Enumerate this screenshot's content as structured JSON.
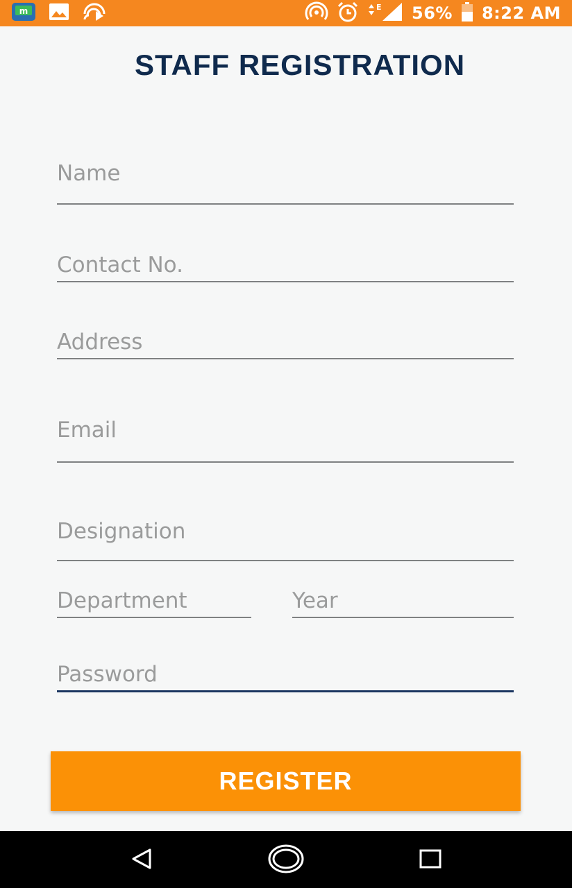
{
  "status_bar": {
    "battery": "56%",
    "time": "8:22 AM",
    "network": "E",
    "icons": [
      "app-m-icon",
      "gallery-icon",
      "cast-icon",
      "hotspot-icon",
      "alarm-icon",
      "signal-icon",
      "battery-icon"
    ]
  },
  "title": "STAFF REGISTRATION",
  "form": {
    "name_placeholder": "Name",
    "contact_placeholder": "Contact No.",
    "address_placeholder": "Address",
    "email_placeholder": "Email",
    "designation_placeholder": "Designation",
    "department_placeholder": "Department",
    "year_placeholder": "Year",
    "password_placeholder": "Password"
  },
  "register_label": "REGISTER",
  "colors": {
    "status_bar": "#f5871f",
    "accent": "#fb9106",
    "title": "#0f2a4d",
    "focused_underline": "#1a3560"
  },
  "nav": {
    "icons": [
      "back-icon",
      "home-icon",
      "recents-icon"
    ]
  }
}
